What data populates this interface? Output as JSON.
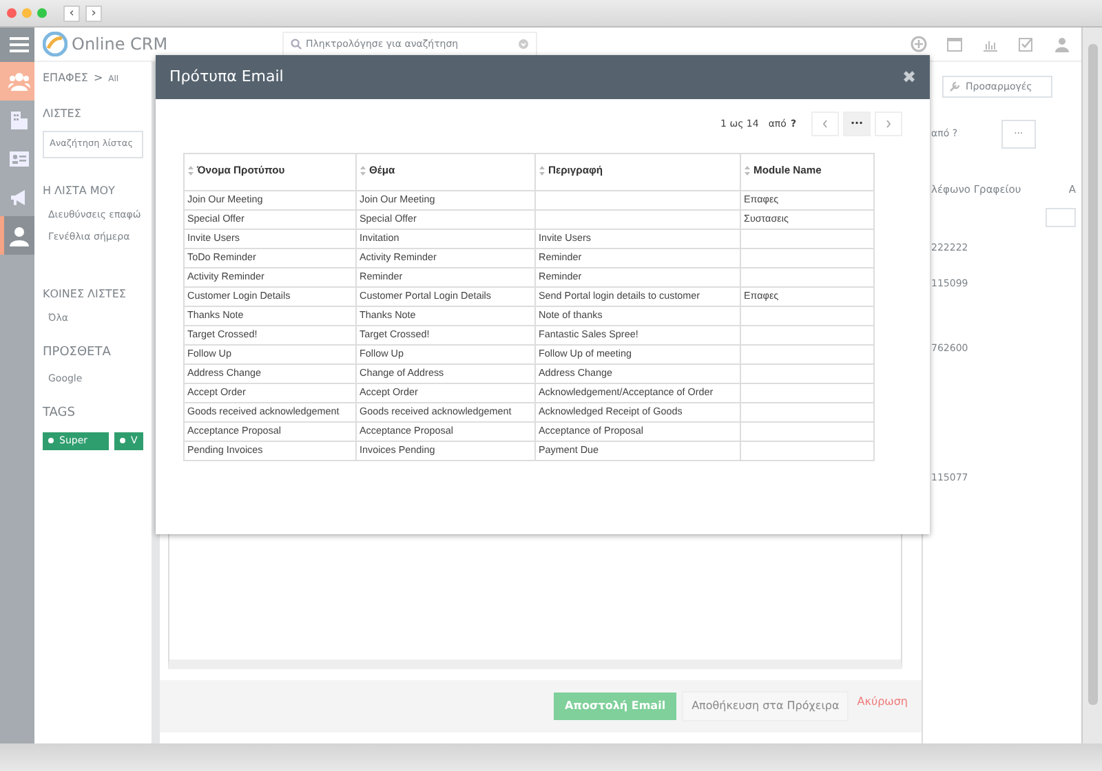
{
  "browser": {
    "back": "‹",
    "forward": "›"
  },
  "app": {
    "logo": "Online CRM",
    "search_placeholder": "Πληκτρολόγησε για αναζήτηση"
  },
  "nav": [
    {
      "kind": "people",
      "selected": true,
      "focused": false
    },
    {
      "kind": "building",
      "selected": false,
      "focused": false
    },
    {
      "kind": "card",
      "selected": false,
      "focused": false
    },
    {
      "kind": "megaphone",
      "selected": false,
      "focused": false
    },
    {
      "kind": "person",
      "selected": false,
      "focused": true
    }
  ],
  "sidebar": {
    "module": "ΕΠΑΦΕΣ",
    "separator": ">",
    "view": "All",
    "lists_heading": "ΛΙΣΤΕΣ",
    "list_search_placeholder": "Αναζήτηση λίστας",
    "sections": [
      {
        "heading": "Η ΛΙΣΤΑ ΜΟΥ",
        "items": [
          "Διευθύνσεις επαφώ",
          "Γενέθλια σήμερα"
        ]
      },
      {
        "heading": "ΚΟΙΝΕΣ ΛΙΣΤΕΣ",
        "items": [
          "Όλα"
        ]
      },
      {
        "heading": "ΠΡΟΣΘΕΤΑ",
        "items": [
          "Google"
        ]
      }
    ],
    "tags_heading": "TAGS",
    "tags": [
      {
        "label": "Super",
        "color": "#2f9e6e"
      },
      {
        "label": "V",
        "color": "#2f9e6e"
      }
    ]
  },
  "compose": {
    "buttons": [
      {
        "kind": "primary",
        "label": "Αποστολή Email"
      },
      {
        "kind": "secondary",
        "label": "Αποθήκευση στα Πρόχειρα"
      },
      {
        "kind": "link",
        "label": "Ακύρωση"
      }
    ]
  },
  "right_pane": {
    "customize": "Προσαρμογές",
    "pagination": "από ?",
    "more": "···",
    "columns": [
      "λέφωνο Γραφείου",
      "Α"
    ],
    "values": [
      "222222",
      "115099",
      "762600",
      "115077"
    ]
  },
  "modal": {
    "title": "Πρότυπα Email",
    "close": "✖",
    "pagination": {
      "range": "1 ως 14",
      "of": "από",
      "total": "?",
      "more": "···"
    },
    "columns": [
      "Όνομα Προτύπου",
      "Θέμα",
      "Περιγραφή",
      "Module Name"
    ],
    "rows": [
      [
        "Join Our Meeting",
        "Join Our Meeting",
        "",
        "Επαφες"
      ],
      [
        "Special Offer",
        "Special Offer",
        "",
        "Συστασεις"
      ],
      [
        "Invite Users",
        "Invitation",
        "Invite Users",
        ""
      ],
      [
        "ToDo Reminder",
        "Activity Reminder",
        "Reminder",
        ""
      ],
      [
        "Activity Reminder",
        "Reminder",
        "Reminder",
        ""
      ],
      [
        "Customer Login Details",
        "Customer Portal Login Details",
        "Send Portal login details to customer",
        "Επαφες"
      ],
      [
        "Thanks Note",
        "Thanks Note",
        "Note of thanks",
        ""
      ],
      [
        "Target Crossed!",
        "Target Crossed!",
        "Fantastic Sales Spree!",
        ""
      ],
      [
        "Follow Up",
        "Follow Up",
        "Follow Up of meeting",
        ""
      ],
      [
        "Address Change",
        "Change of Address",
        "Address Change",
        ""
      ],
      [
        "Accept Order",
        "Accept Order",
        "Acknowledgement/Acceptance of Order",
        ""
      ],
      [
        "Goods received acknowledgement",
        "Goods received acknowledgement",
        "Acknowledged Receipt of Goods",
        ""
      ],
      [
        "Acceptance Proposal",
        "Acceptance Proposal",
        "Acceptance of Proposal",
        ""
      ],
      [
        "Pending Invoices",
        "Invoices Pending",
        "Payment Due",
        ""
      ]
    ]
  }
}
